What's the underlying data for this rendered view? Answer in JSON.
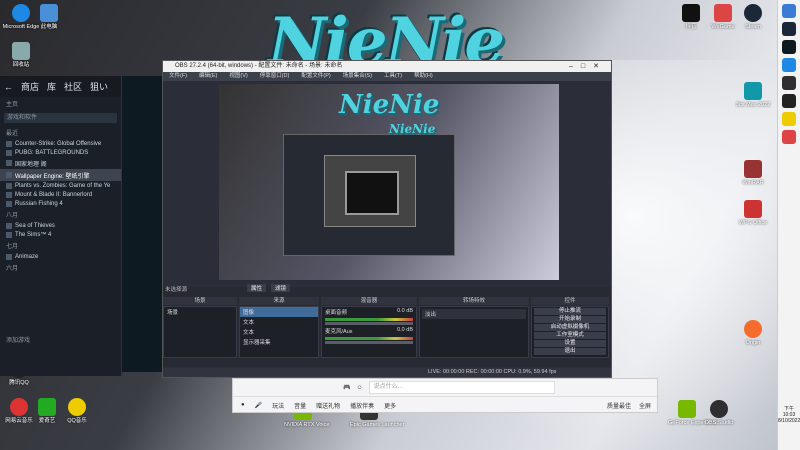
{
  "desktop": {
    "logo_text": "NieNie",
    "nested_logo_1": "NieNie",
    "nested_logo_2": "NieNie",
    "icons": [
      {
        "label": "Microsoft Edge",
        "color": "#1e88e5"
      },
      {
        "label": "此电脑",
        "color": "#4a90d9"
      },
      {
        "label": "回收站",
        "color": "#8aa"
      },
      {
        "label": "网易云音乐",
        "color": "#d33"
      },
      {
        "label": "爱奇艺",
        "color": "#2a2"
      },
      {
        "label": "QQ音乐",
        "color": "#ec0"
      },
      {
        "label": "腾讯QQ",
        "color": "#222"
      },
      {
        "label": "NVIDIA RTX Voice",
        "color": "#76b900"
      },
      {
        "label": "Epic Games Launcher",
        "color": "#333"
      },
      {
        "label": "WeGame",
        "color": "#d44"
      },
      {
        "label": "Steam",
        "color": "#1b2838"
      },
      {
        "label": "3ds Max 2022",
        "color": "#19a"
      },
      {
        "label": "WinRAR",
        "color": "#933"
      },
      {
        "label": "WPS Office",
        "color": "#c33"
      },
      {
        "label": "Origin",
        "color": "#f56c2d"
      },
      {
        "label": "抖音",
        "color": "#111"
      },
      {
        "label": "OBS Studio",
        "color": "#302e31"
      },
      {
        "label": "GeForce Experience",
        "color": "#76b900"
      }
    ]
  },
  "steam": {
    "nav": [
      "商店",
      "库",
      "社区",
      "狙い"
    ],
    "search_placeholder": "游戏和软件",
    "home": "主页",
    "section_recent": "最近",
    "section_aug": "八月",
    "section_jul": "七月",
    "section_jun": "六月",
    "games": [
      "Counter-Strike: Global Offensive",
      "PUBG: BATTLEGROUNDS",
      "国家地理 阁",
      "Wallpaper Engine: 壁纸引擎",
      "Plants vs. Zombies: Game of the Ye",
      "Mount & Blade II: Bannerlord",
      "Russian Fishing 4"
    ],
    "games_aug": [
      "Sea of Thieves",
      "The Sims™ 4"
    ],
    "games_jul": [
      "Animaze"
    ],
    "add_game": "添加游戏"
  },
  "obs": {
    "title": "OBS 27.2.4 (64-bit, windows) - 配置文件: 未命名 - 场景: 未命名",
    "menu": [
      "文件(F)",
      "编辑(E)",
      "视图(V)",
      "停靠窗口(D)",
      "配置文件(P)",
      "场景集合(S)",
      "工具(T)",
      "帮助(H)"
    ],
    "no_source": "未选择源",
    "properties": "属性",
    "filters": "滤镜",
    "docks": {
      "scenes": "场景",
      "sources": "来源",
      "mixer": "混音器",
      "transitions": "转场特效",
      "controls": "控件"
    },
    "scene_item": "场景",
    "sources": [
      "图像",
      "文本",
      "文本",
      "显示器采集"
    ],
    "mixer_items": [
      "桌面音频",
      "麦克风/Aux"
    ],
    "mixer_level": "0.0 dB",
    "transition": "淡出",
    "controls": [
      "停止推流",
      "开始录制",
      "启动虚拟摄像机",
      "工作室模式",
      "设置",
      "退出"
    ],
    "status": "LIVE: 00:00:00   REC: 00:00:00   CPU: 0.9%, 59.94 fps"
  },
  "qq": {
    "input_placeholder": "说点什么...",
    "bottom": [
      "玩法",
      "音量",
      "赠送礼物",
      "播放伴奏",
      "更多"
    ],
    "right": [
      "质量最佳",
      "全屏"
    ]
  },
  "taskbar": {
    "time": "下午 10:03",
    "date": "8/10/2022"
  }
}
